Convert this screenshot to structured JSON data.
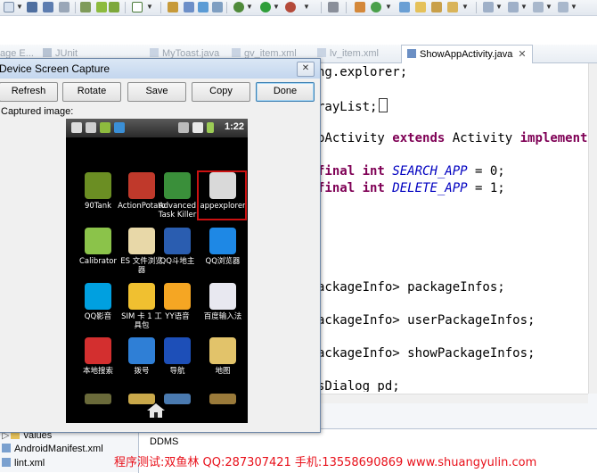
{
  "toolbar": {
    "icons": [
      "new-icon",
      "save-icon",
      "save-all-icon",
      "print-icon",
      "debug-icon",
      "run-icon",
      "search-icon",
      "open-type-icon",
      "next-annotation-icon",
      "back-icon",
      "forward-icon"
    ]
  },
  "tabs": [
    {
      "label": "age E...",
      "icon": "java-file-icon"
    },
    {
      "label": "JUnit",
      "icon": "junit-icon"
    },
    {
      "label": "MyToast.java",
      "icon": "java-file-icon"
    },
    {
      "label": "gv_item.xml",
      "icon": "xml-file-icon"
    },
    {
      "label": "lv_item.xml",
      "icon": "xml-file-icon"
    },
    {
      "label": "ShowAppActivity.java",
      "icon": "java-file-icon"
    }
  ],
  "editor": {
    "line1": "ng.explorer;",
    "line2": "rayList;",
    "line3a": "pActivity ",
    "line3kw1": "extends",
    "line3b": " Activity ",
    "line3kw2": "implements",
    "line4kw": "final int ",
    "line4it": "SEARCH_APP",
    "line4b": " = 0;",
    "line5kw": "final int ",
    "line5it": "DELETE_APP",
    "line5b": " = 1;",
    "line6": "ackageInfo> packageInfos;",
    "line7": "ackageInfo> userPackageInfos;",
    "line8": "ackageInfo> showPackageInfos;",
    "line9": "sDialog pd;"
  },
  "tree": [
    {
      "label": "values",
      "icon": "folder-icon"
    },
    {
      "label": "AndroidManifest.xml",
      "icon": "xml-file-icon"
    },
    {
      "label": "lint.xml",
      "icon": "xml-file-icon"
    }
  ],
  "ddms_label": "DDMS",
  "watermark": "程序测试:双鱼林 QQ:287307421 手机:13558690869 www.shuangyulin.com",
  "dialog": {
    "title": "Device Screen Capture",
    "close": "✕",
    "buttons": [
      "Refresh",
      "Rotate",
      "Save",
      "Copy",
      "Done"
    ],
    "captured_label": "Captured image:"
  },
  "phone": {
    "time": "1:22",
    "apps": [
      {
        "label": "90Tank",
        "color": "#6b8e23"
      },
      {
        "label": "ActionPotato",
        "color": "#c0392b"
      },
      {
        "label": "Advanced Task Killer",
        "color": "#3a8f3a"
      },
      {
        "label": "appexplorer",
        "color": "#d9d9d9"
      },
      {
        "label": "Calibrator",
        "color": "#8bc34a"
      },
      {
        "label": "ES 文件浏览器",
        "color": "#e8d8a8"
      },
      {
        "label": "QQ斗地主",
        "color": "#2a5db0"
      },
      {
        "label": "QQ浏览器",
        "color": "#1e88e5"
      },
      {
        "label": "QQ影音",
        "color": "#00a0e0"
      },
      {
        "label": "SIM 卡 1 工具包",
        "color": "#f0c030"
      },
      {
        "label": "YY语音",
        "color": "#f5a623"
      },
      {
        "label": "百度输入法",
        "color": "#e8e8f0"
      },
      {
        "label": "本地搜索",
        "color": "#d32f2f"
      },
      {
        "label": "拨号",
        "color": "#2f7fd6"
      },
      {
        "label": "导航",
        "color": "#1d4fb8"
      },
      {
        "label": "地图",
        "color": "#e2c36a"
      }
    ]
  }
}
